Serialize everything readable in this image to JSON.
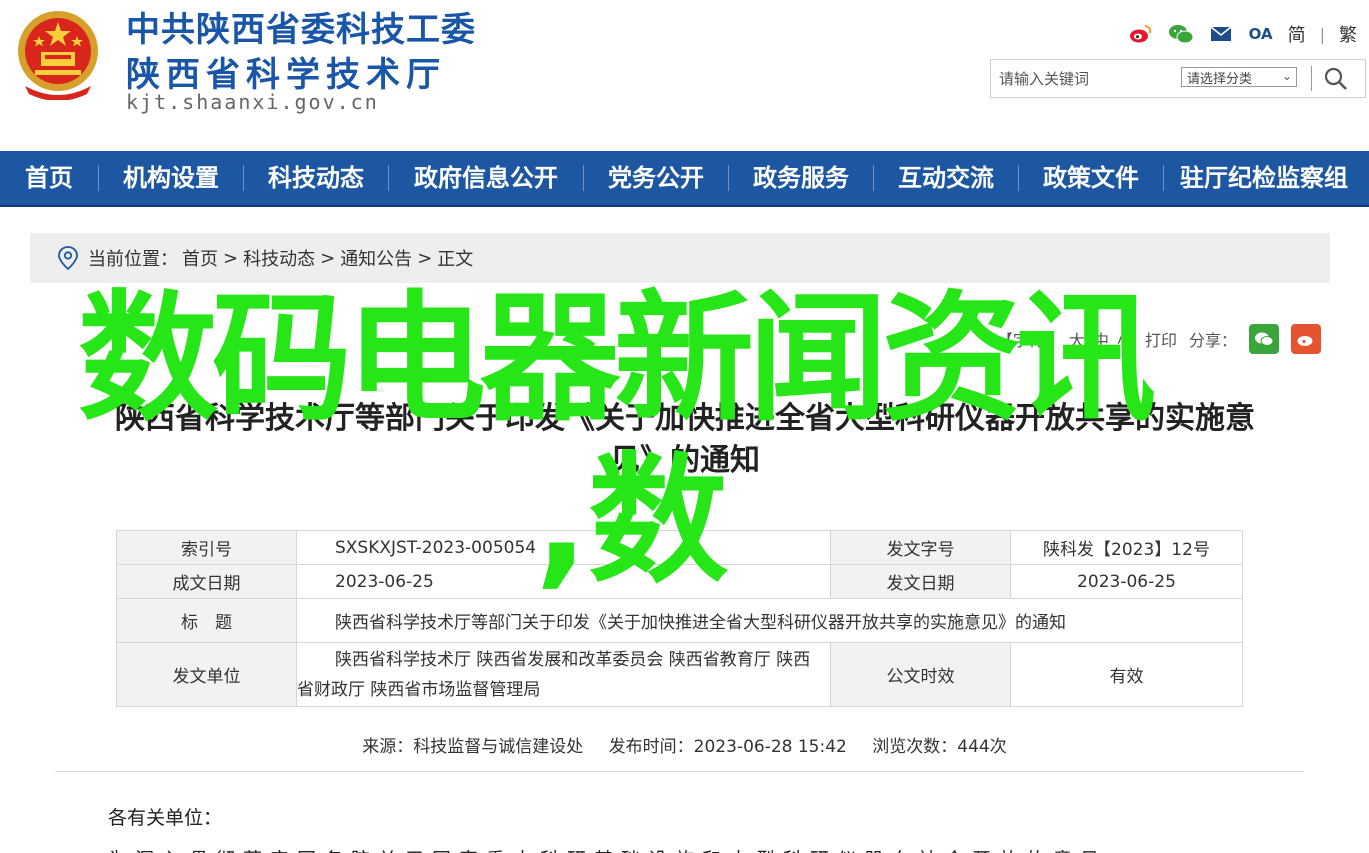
{
  "header": {
    "org_line1": "中共陕西省委科技工委",
    "org_line2": "陕西省科学技术厅",
    "domain": "kjt.shaanxi.gov.cn",
    "tool_icons": [
      "weibo-icon",
      "wechat-icon",
      "mail-icon",
      "oa-icon"
    ],
    "oa_label": "OA",
    "lang_simplified": "简",
    "lang_sep": "|",
    "lang_traditional": "繁",
    "search": {
      "placeholder": "请输入关键词",
      "category_label": "请选择分类"
    }
  },
  "nav": {
    "items": [
      "首页",
      "机构设置",
      "科技动态",
      "政府信息公开",
      "党务公开",
      "政务服务",
      "互动交流",
      "政策文件",
      "驻厅纪检监察组"
    ]
  },
  "breadcrumb": {
    "prefix": "当前位置：",
    "items": [
      "首页",
      "科技动态",
      "通知公告",
      "正文"
    ],
    "sep": ">"
  },
  "meta": {
    "font_label": "【字体：",
    "font_large": "大",
    "font_medium": "中",
    "font_small": "小",
    "print": "打印",
    "share_label": "分享："
  },
  "title": {
    "line1": "陕西省科学技术厅等部门关于印发《关于加快推进全省大型科研仪器开放共享的实施意",
    "line2": "见》的通知"
  },
  "watermark": {
    "line1": "数码电器新闻资讯",
    "line2": ",数"
  },
  "info": {
    "rows": [
      {
        "l1": "索引号",
        "v1": "SXSKXJST-2023-005054",
        "l2": "发文字号",
        "v2": "陕科发【2023】12号"
      },
      {
        "l1": "成文日期",
        "v1": "2023-06-25",
        "l2": "发文日期",
        "v2": "2023-06-25"
      }
    ],
    "title_label": "标　题",
    "title_value": "陕西省科学技术厅等部门关于印发《关于加快推进全省大型科研仪器开放共享的实施意见》的通知",
    "issuer_label": "发文单位",
    "issuer_value_line1": "陕西省科学技术厅 陕西省发展和改革委员会 陕西省教育厅 陕西",
    "issuer_value_line2": "省财政厅 陕西省市场监督管理局",
    "validity_label": "公文时效",
    "validity_value": "有效"
  },
  "source": {
    "source": "来源：科技监督与诚信建设处",
    "published": "发布时间：2023-06-28 15:42",
    "views": "浏览次数：444次"
  },
  "body": {
    "greeting": "各有关单位：",
    "cut_line": "为深入贯彻落实国务院关于国家重大科研基础设施和大型科研仪器向社会开放的意见"
  },
  "colors": {
    "brand_blue": "#1d56a1",
    "watermark_green": "#27e617"
  }
}
